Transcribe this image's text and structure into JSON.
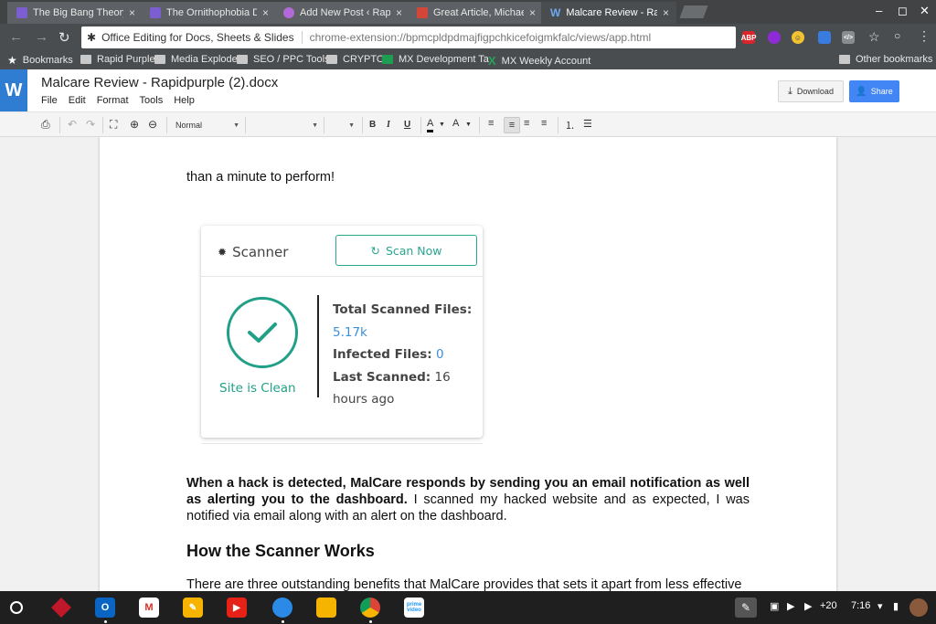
{
  "browser": {
    "tabs": [
      {
        "title": "The Big Bang Theory | Th",
        "favicon_color": "#7b5fd0",
        "active": false
      },
      {
        "title": "The Ornithophobia Diffus",
        "favicon_color": "#7b5fd0",
        "active": false
      },
      {
        "title": "Add New Post ‹ Rapid Pu",
        "favicon_color": "#b26ad8",
        "active": false
      },
      {
        "title": "Great Article, Michael :)",
        "favicon_color": "#d44638",
        "active": false
      },
      {
        "title": "Malcare Review - Rapidpu",
        "favicon_color": "#2f7cd3",
        "favicon_letter": "W",
        "active": true
      }
    ],
    "tab_close": "×",
    "window_controls": {
      "minimize": "–",
      "restore": "◻",
      "close": "✕"
    },
    "nav": {
      "back": "←",
      "forward": "→",
      "reload": "↻"
    },
    "omnibox": {
      "extension_name": "Office Editing for Docs, Sheets & Slides",
      "url": "chrome-extension://bpmcpldpdmajfigpchkicefoigmkfalc/views/app.html"
    },
    "extensions": [
      {
        "icon": "adblock-plus-icon",
        "label": "ABP",
        "color": "#d9262c"
      },
      {
        "icon": "purple-extension-icon",
        "label": "",
        "color": "#8e2bd6"
      },
      {
        "icon": "emoji-extension-icon",
        "label": "☺",
        "color": "#f1c232"
      },
      {
        "icon": "blue-extension-icon",
        "label": "",
        "color": "#3a7be0"
      },
      {
        "icon": "code-extension-icon",
        "label": "</>",
        "color": "#8a8d90"
      }
    ],
    "bookmark_star": "☆",
    "bookmarks": [
      "Bookmarks",
      "Rapid Purple",
      "Media Explode",
      "SEO / PPC Tools",
      "CRYPTO",
      "MX Development Ta",
      "MX Weekly Account",
      "Other bookmarks"
    ]
  },
  "app": {
    "logo_letter": "W",
    "doc_title": "Malcare Review - Rapidpurple (2).docx",
    "menu": [
      "File",
      "Edit",
      "Format",
      "Tools",
      "Help"
    ],
    "download_label": "Download",
    "share_label": "Share"
  },
  "format_toolbar": {
    "style_value": "Normal",
    "font_value": "",
    "size_value": "",
    "bold": "B",
    "italic": "I",
    "underline": "U",
    "text_color": "A",
    "highlight": "A"
  },
  "document": {
    "line_top": "than a minute to perform!",
    "card": {
      "title": "Scanner",
      "scan_button": "Scan Now",
      "status": "Site is Clean",
      "total_label": "Total Scanned Files:",
      "total_value": "5.17k",
      "infected_label": "Infected Files:",
      "infected_value": "0",
      "last_label": "Last Scanned:",
      "last_value_1": "16",
      "last_value_2": "hours ago"
    },
    "para_bold": "When a hack is detected, MalCare responds by sending you an email notification as well as alerting you to the dashboard.",
    "para_rest": " I scanned my hacked website and as expected, I was notified via email along with an alert on the dashboard.",
    "heading": "How the Scanner Works",
    "para_next": "There are three outstanding benefits that MalCare provides that sets it apart from less effective"
  },
  "shelf": {
    "apps": [
      {
        "icon": "pixel-game-icon",
        "color": "#c0182a"
      },
      {
        "icon": "outlook-icon",
        "color": "#0a64c4",
        "label": "O"
      },
      {
        "icon": "gmail-icon",
        "color": "#ffffff",
        "label": "M"
      },
      {
        "icon": "keep-icon",
        "color": "#f6b400",
        "label": "💡"
      },
      {
        "icon": "youtube-icon",
        "color": "#e62117",
        "label": "▶"
      },
      {
        "icon": "files-icon",
        "color": "#2a8ae6",
        "label": ""
      },
      {
        "icon": "docs-folder-icon",
        "color": "#f5b400",
        "label": ""
      },
      {
        "icon": "chrome-icon",
        "color": "#db4437",
        "label": ""
      },
      {
        "icon": "prime-video-icon",
        "color": "#ffffff",
        "label": "prime video"
      }
    ],
    "tray": {
      "notifications": "+20",
      "time": "7:16"
    }
  }
}
